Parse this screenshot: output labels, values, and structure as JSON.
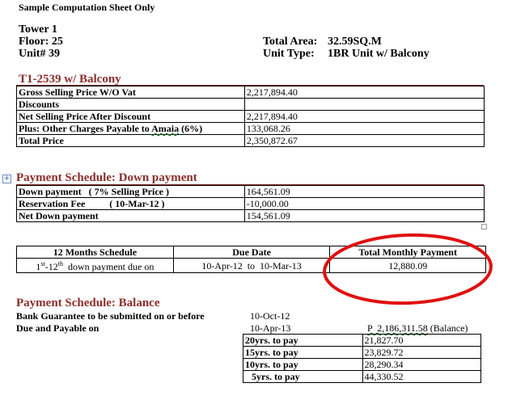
{
  "doc_title": "Sample Computation Sheet Only",
  "info": {
    "tower": "Tower 1",
    "floor": "Floor: 25",
    "unit": "Unit# 39",
    "total_area_label": "Total Area:",
    "total_area_value": "32.59SQ.M",
    "unit_type_label": "Unit Type:",
    "unit_type_value": "1BR Unit w/ Balcony"
  },
  "price_section": {
    "title": "T1-2539 w/ Balcony",
    "rows": [
      {
        "label": "Gross Selling Price W/O Vat",
        "value": "2,217,894.40"
      },
      {
        "label": "Discounts",
        "value": ""
      },
      {
        "label": "Net Selling Price After Discount",
        "value": "2,217,894.40"
      },
      {
        "label_prefix": "Plus: Other Charges Payable to ",
        "label_brand": "Amaia",
        "label_suffix": " (6%)",
        "value": "133,068.26"
      },
      {
        "label": "Total Price",
        "value": "2,350,872.67"
      }
    ]
  },
  "down_section": {
    "title": "Payment Schedule: Down payment",
    "rows": [
      {
        "label": "Down payment   ( 7% Selling Price )",
        "value": "164,561.09"
      },
      {
        "label": "Reservation Fee          ( 10-Mar-12 )",
        "value": "-10,000.00"
      },
      {
        "label": "Net Down payment",
        "value": "154,561.09"
      }
    ]
  },
  "monthly": {
    "headers": [
      "12 Months Schedule",
      "Due Date",
      "Total Monthly Payment"
    ],
    "row": {
      "schedule_a": "1",
      "schedule_sup_a": "st",
      "schedule_b": "-12",
      "schedule_sup_b": "th",
      "schedule_c": "  down payment due on",
      "due_date": "10-Apr-12  to  10-Mar-13",
      "amount": "12,880.09"
    }
  },
  "balance_section": {
    "title": "Payment Schedule: Balance",
    "bank_label": "Bank Guarantee to be submitted on or before",
    "bank_date": "10-Oct-12",
    "due_label": "Due and Payable on",
    "due_date": "10-Apr-13",
    "balance_amount": "P  2,186,311.58",
    "balance_note": " (Balance)",
    "terms": [
      {
        "label": "20yrs. to pay",
        "value": "21,827.70"
      },
      {
        "label": "15yrs. to pay",
        "value": "23,829.72"
      },
      {
        "label": "10yrs. to pay",
        "value": "28,290.34"
      },
      {
        "label": "5yrs. to pay",
        "value": "44,330.52"
      }
    ]
  },
  "colors": {
    "section_title": "#8b2e2a",
    "highlight_circle": "#e01010",
    "anchor_icon": "#3a5fa0"
  }
}
